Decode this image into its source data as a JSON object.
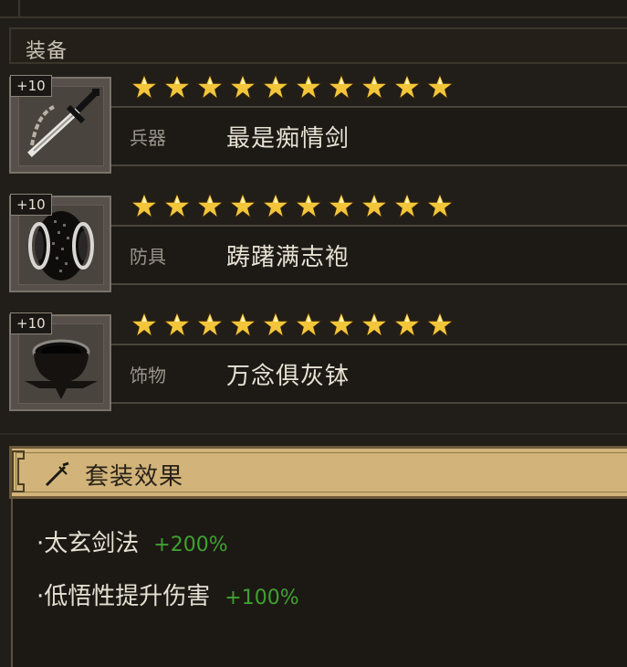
{
  "section": {
    "title": "装备"
  },
  "equipment": [
    {
      "level": "+10",
      "type": "兵器",
      "name": "最是痴情剑",
      "stars": 10,
      "icon": "sword-icon"
    },
    {
      "level": "+10",
      "type": "防具",
      "name": "踌躇满志袍",
      "stars": 10,
      "icon": "robe-icon"
    },
    {
      "level": "+10",
      "type": "饰物",
      "name": "万念俱灰钵",
      "stars": 10,
      "icon": "bowl-icon"
    }
  ],
  "set_bonus": {
    "title": "套装效果",
    "icon": "sword-icon",
    "effects": [
      {
        "text": "·太玄剑法",
        "value": "+200%"
      },
      {
        "text": "·低悟性提升伤害",
        "value": "+100%"
      }
    ]
  },
  "colors": {
    "star": "#f3c53a",
    "bonus_value": "#3fa22f",
    "header_bg": "#d2b47a"
  }
}
